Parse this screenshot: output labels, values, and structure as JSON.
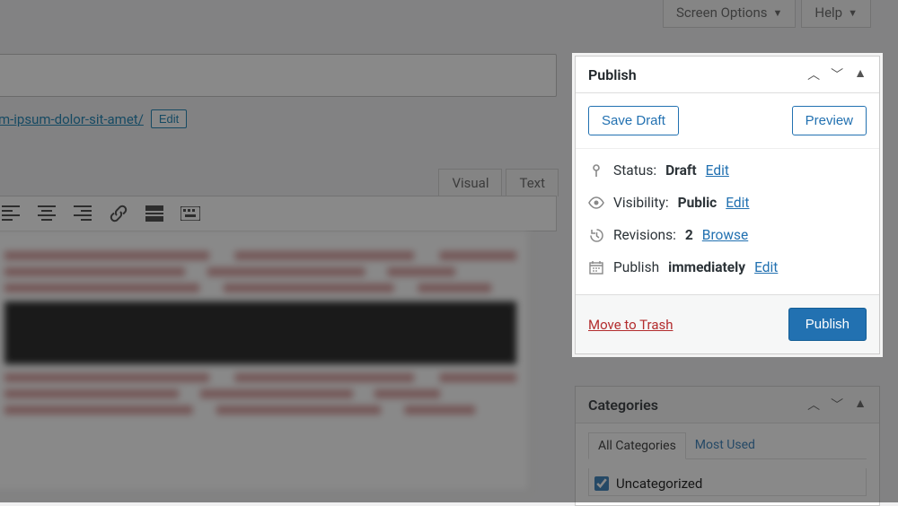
{
  "top": {
    "screen_options": "Screen Options",
    "help": "Help"
  },
  "permalink": {
    "url_suffix": "em-ipsum-dolor-sit-amet/",
    "edit": "Edit"
  },
  "editor_tabs": {
    "visual": "Visual",
    "text": "Text"
  },
  "publish": {
    "title": "Publish",
    "save_draft": "Save Draft",
    "preview": "Preview",
    "status_label": "Status:",
    "status_value": "Draft",
    "status_edit": "Edit",
    "visibility_label": "Visibility:",
    "visibility_value": "Public",
    "visibility_edit": "Edit",
    "revisions_label": "Revisions:",
    "revisions_count": "2",
    "revisions_browse": "Browse",
    "schedule_label": "Publish",
    "schedule_value": "immediately",
    "schedule_edit": "Edit",
    "move_to_trash": "Move to Trash",
    "publish_btn": "Publish"
  },
  "categories": {
    "title": "Categories",
    "tab_all": "All Categories",
    "tab_most_used": "Most Used",
    "item_uncategorized": "Uncategorized"
  }
}
